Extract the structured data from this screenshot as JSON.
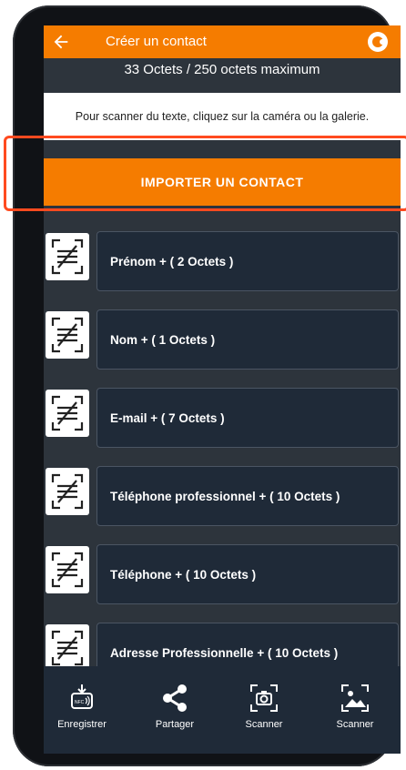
{
  "header": {
    "title": "Créer un contact",
    "back_icon": "arrow-left-icon",
    "menu_icon": "contact-toggle-icon"
  },
  "bytes_info": "33 Octets / 250 octets maximum",
  "hint_text": "Pour scanner du texte, cliquez sur la caméra ou la galerie.",
  "import_button": "IMPORTER UN CONTACT",
  "fields": [
    {
      "label": "Prénom + ( 2 Octets )"
    },
    {
      "label": "Nom + ( 1 Octets )"
    },
    {
      "label": "E-mail + ( 7 Octets )"
    },
    {
      "label": "Téléphone professionnel + ( 10 Octets )"
    },
    {
      "label": "Téléphone  + ( 10 Octets )"
    },
    {
      "label": "Adresse Professionnelle + ( 10 Octets )"
    }
  ],
  "bottom_nav": [
    {
      "label": "Enregistrer",
      "icon": "nfc-download-icon"
    },
    {
      "label": "Partager",
      "icon": "share-icon"
    },
    {
      "label": "Scanner",
      "icon": "camera-scan-icon"
    },
    {
      "label": "Scanner",
      "icon": "image-scan-icon"
    }
  ],
  "colors": {
    "accent": "#f57c00",
    "background": "#2d343c",
    "field": "#1f2a38",
    "highlight": "#ff4a1f"
  }
}
